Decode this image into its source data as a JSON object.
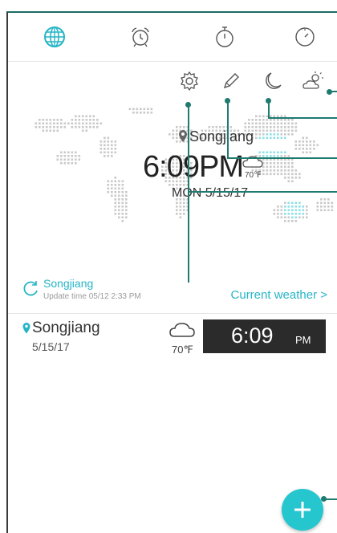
{
  "tabs": [
    {
      "name": "world-clock",
      "icon": "globe-icon",
      "active": true
    },
    {
      "name": "alarm",
      "icon": "alarm-icon"
    },
    {
      "name": "stopwatch",
      "icon": "stopwatch-icon"
    },
    {
      "name": "timer",
      "icon": "timer-icon"
    }
  ],
  "toolbar": {
    "icons": [
      "gear-icon",
      "pencil-icon",
      "moon-icon",
      "weather-icon"
    ]
  },
  "map_overlay": {
    "city": "Songjiang",
    "time": "6:09",
    "ampm": "PM",
    "temp": "70℉",
    "date": "MON 5/15/17"
  },
  "update": {
    "city": "Songjiang",
    "time_text": "Update time 05/12 2:33 PM",
    "current_weather": "Current weather >"
  },
  "clocks": [
    {
      "city": "Songjiang",
      "date": "5/15/17",
      "temp": "70℉",
      "time": "6:09",
      "ampm": "PM"
    }
  ],
  "fab": {
    "icon": "plus-icon"
  },
  "colors": {
    "accent": "#26b5c6",
    "fab": "#26c6cf",
    "callout": "#1f7a70",
    "clock_bg": "#2b2b2b"
  }
}
